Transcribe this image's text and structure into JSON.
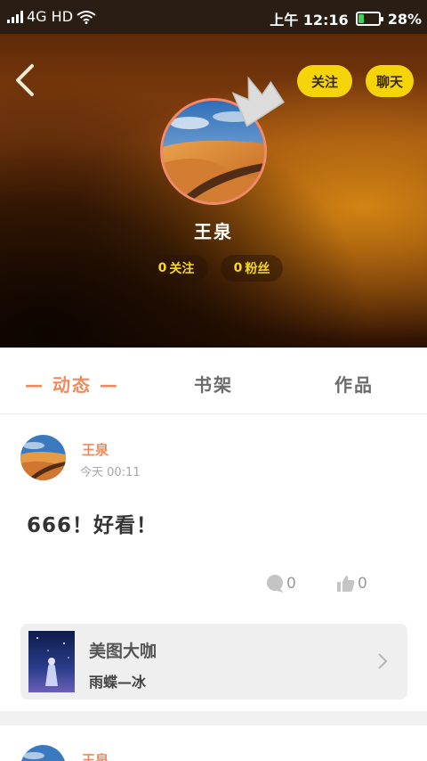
{
  "status_bar": {
    "network": "4G HD",
    "time": "上午 12:16",
    "battery": "28%",
    "battery_level": 0.28
  },
  "profile": {
    "name": "王泉",
    "follow_button": "关注",
    "chat_button": "聊天",
    "following_count": "0",
    "following_label": "关注",
    "fans_count": "0",
    "fans_label": "粉丝"
  },
  "tabs": [
    {
      "label": "— 动态 —",
      "active": true
    },
    {
      "label": "书架",
      "active": false
    },
    {
      "label": "作品",
      "active": false
    }
  ],
  "posts": [
    {
      "author": "王泉",
      "time": "今天 00:11",
      "text": "666！好看！",
      "comments": "0",
      "likes": "0",
      "book": {
        "title": "美图大咖",
        "author": "雨蝶—冰"
      }
    },
    {
      "author": "王泉"
    }
  ],
  "icons": {
    "back": "chevron-left-icon",
    "crown": "crown-icon",
    "comment": "comment-bubble-icon",
    "like": "thumbs-up-icon",
    "book_arrow": "chevron-right-icon"
  },
  "colors": {
    "accent": "#ef8a5e",
    "button_yellow": "#f6d40a",
    "stat_text": "#f7d91d"
  }
}
